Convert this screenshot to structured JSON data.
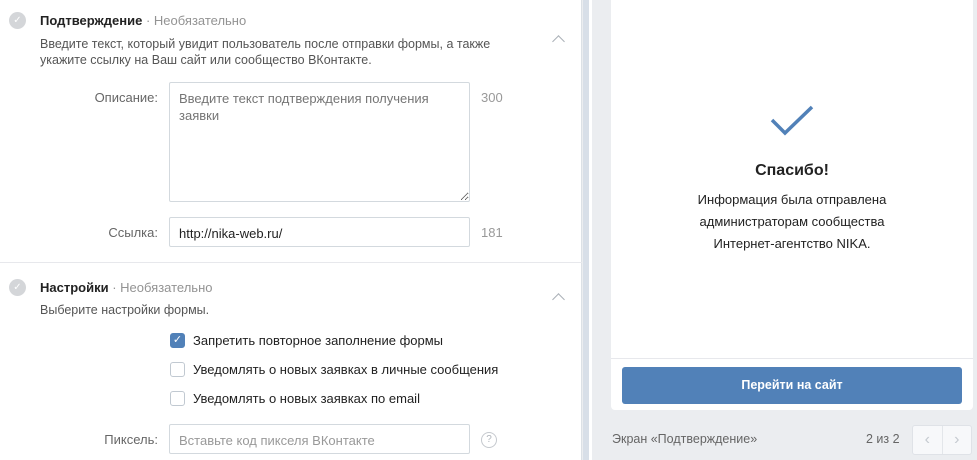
{
  "confirmation": {
    "title": "Подтверждение",
    "optional": "· Необязательно",
    "description": "Введите текст, который увидит пользователь после отправки формы, а также укажите ссылку на Ваш сайт или сообщество ВКонтакте.",
    "description_label": "Описание:",
    "description_placeholder": "Введите текст подтверждения получения заявки",
    "description_count": "300",
    "link_label": "Ссылка:",
    "link_value": "http://nika-web.ru/",
    "link_count": "181"
  },
  "settings": {
    "title": "Настройки",
    "optional": "· Необязательно",
    "description": "Выберите настройки формы.",
    "checkboxes": [
      {
        "label": "Запретить повторное заполнение формы",
        "checked": true
      },
      {
        "label": "Уведомлять о новых заявках в личные сообщения",
        "checked": false
      },
      {
        "label": "Уведомлять о новых заявках по email",
        "checked": false
      }
    ],
    "pixel_label": "Пиксель:",
    "pixel_placeholder": "Вставьте код пикселя ВКонтакте",
    "help": "?"
  },
  "preview": {
    "thanks": "Спасибо!",
    "info": "Информация была отправлена администраторам сообщества Интернет-агентство NIKA.",
    "button": "Перейти на сайт",
    "screen_label": "Экран «Подтверждение»",
    "pages": "2 из 2",
    "prev": "‹",
    "next": "›"
  },
  "colors": {
    "accent": "#5181b8",
    "background": "#ebedf0"
  }
}
